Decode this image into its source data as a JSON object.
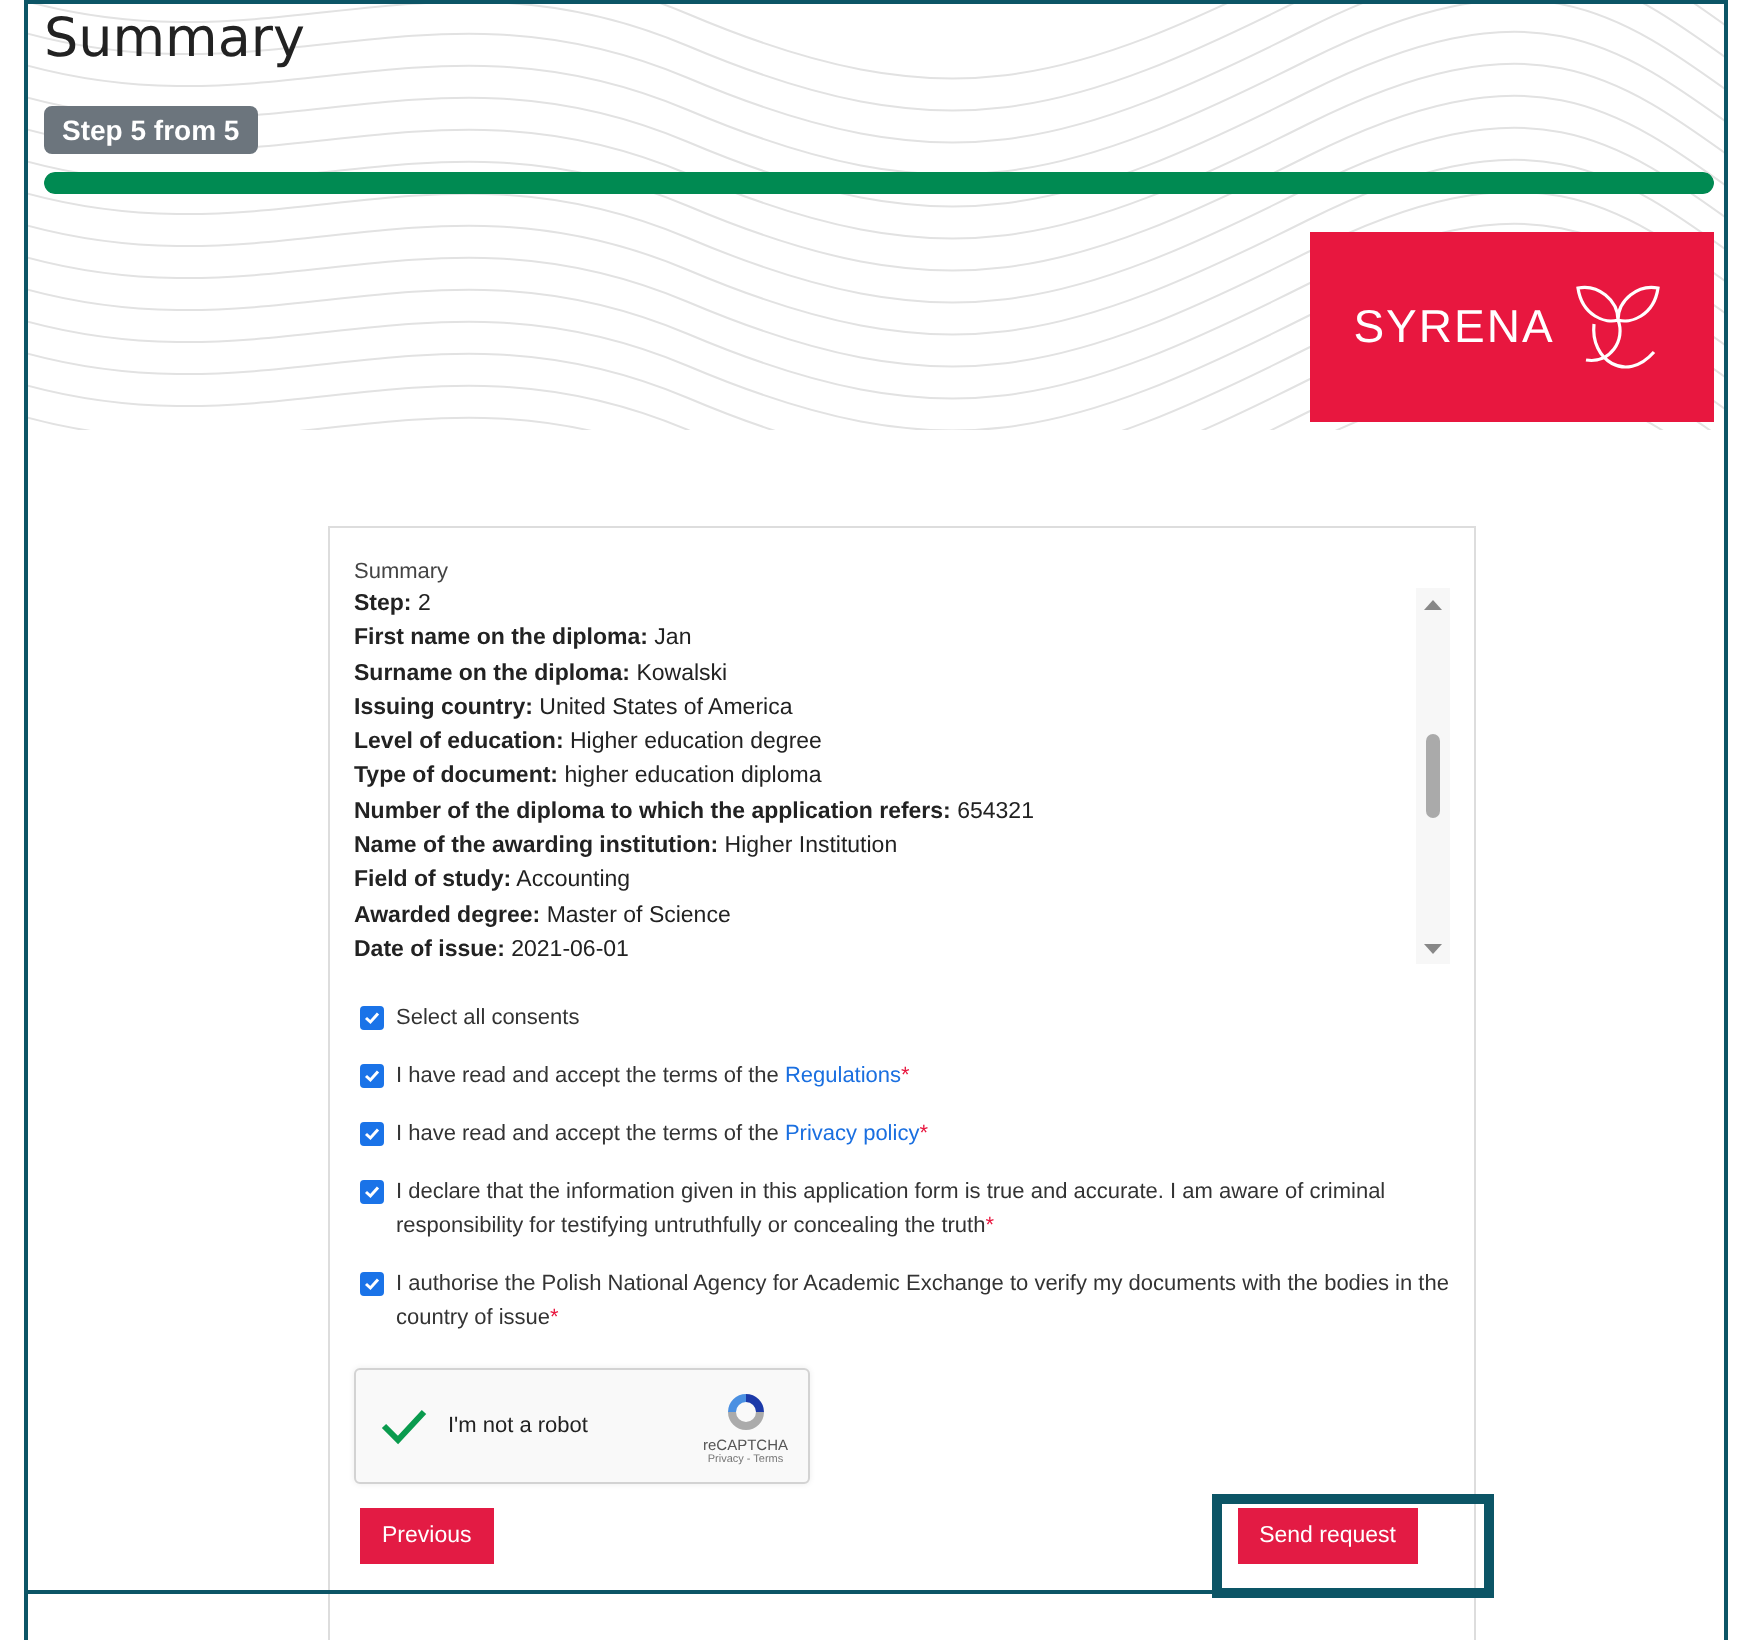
{
  "title": "Summary",
  "step_badge": "Step 5 from 5",
  "progress": {
    "level": 1
  },
  "logo": {
    "text": "SYRENA"
  },
  "card": {
    "label": "Summary",
    "rows": [
      {
        "label": "Step:",
        "value": "2"
      },
      {
        "label": "First name on the diploma:",
        "value": "Jan"
      },
      {
        "label": "Surname on the diploma:",
        "value": "Kowalski"
      },
      {
        "label": "Issuing country:",
        "value": "United States of America"
      },
      {
        "label": "Level of education:",
        "value": "Higher education degree"
      },
      {
        "label": "Type of document:",
        "value": "higher education diploma"
      },
      {
        "label": "Number of the diploma to which the application refers:",
        "value": "654321"
      },
      {
        "label": "Name of the awarding institution:",
        "value": "Higher Institution"
      },
      {
        "label": "Field of study:",
        "value": "Accounting"
      },
      {
        "label": "Awarded degree:",
        "value": "Master of Science"
      },
      {
        "label": "Date of issue:",
        "value": "2021-06-01"
      }
    ],
    "consents": [
      {
        "text": "Select all consents",
        "checked": true
      },
      {
        "text": "I have read and accept the terms of the ",
        "link": "Regulations",
        "checked": true,
        "required_mark": "*"
      },
      {
        "text": "I have read and accept the terms of the ",
        "link": "Privacy policy",
        "checked": true,
        "required_mark": "*"
      },
      {
        "text": "I declare that the information given in this application form is true and accurate. I am aware of criminal responsibility for testifying untruthfully or concealing the truth",
        "checked": true,
        "required_mark": "*"
      },
      {
        "text": "I authorise the Polish National Agency for Academic Exchange to verify my documents with the bodies in the country of issue",
        "checked": true,
        "required_mark": "*"
      }
    ],
    "captcha": {
      "label": "I'm not a robot",
      "checked": true,
      "brand": "reCAPTCHA",
      "footer": "Privacy - Terms"
    },
    "buttons": [
      "Previous",
      "Send request"
    ]
  }
}
